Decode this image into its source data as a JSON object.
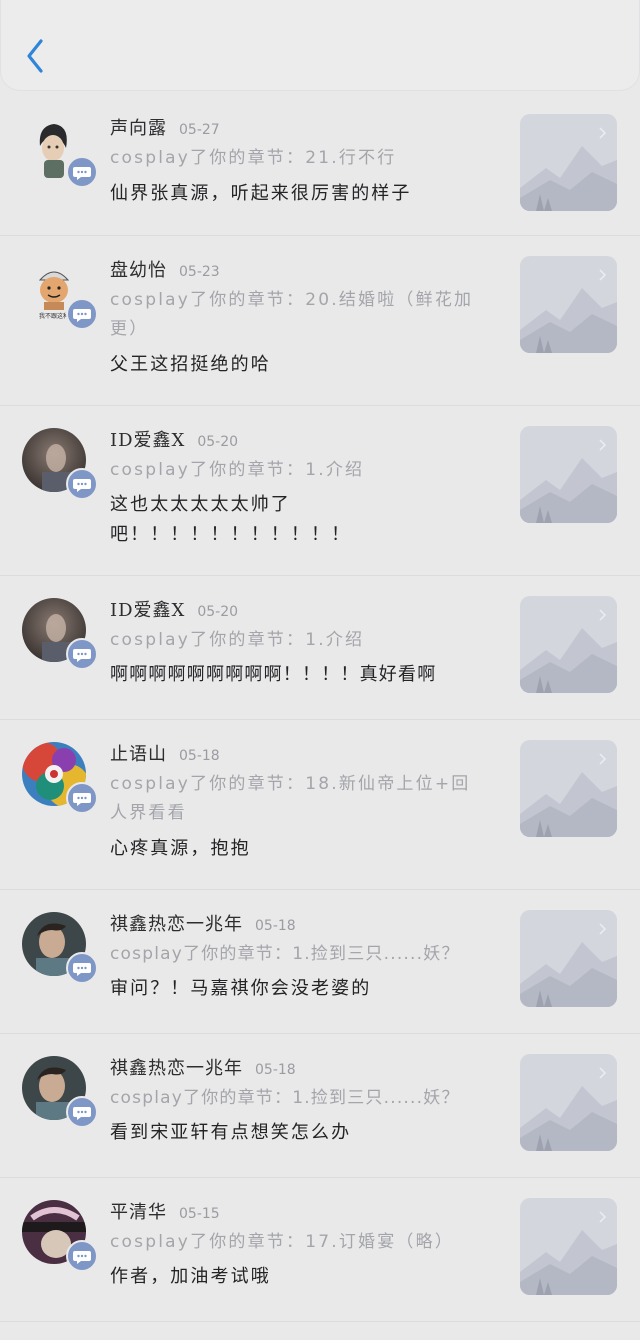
{
  "header": {
    "back_icon": "chevron-left-icon",
    "accent_color": "#2f86d8"
  },
  "comments": [
    {
      "name": "声向露",
      "date": "05-27",
      "subject": "cosplay了你的章节：21.行不行",
      "comment": "仙界张真源，听起来很厉害的样子",
      "avatar_caption": ""
    },
    {
      "name": "盘幼怡",
      "date": "05-23",
      "subject": "cosplay了你的章节：20.结婚啦（鲜花加更）",
      "comment": "父王这招挺绝的哈",
      "avatar_caption": "我不跟这种"
    },
    {
      "name": "ID爱鑫X",
      "date": "05-20",
      "subject": "cosplay了你的章节：1.介绍",
      "comment": "这也太太太太太帅了吧！！！！！！！！！！！",
      "avatar_caption": ""
    },
    {
      "name": "ID爱鑫X",
      "date": "05-20",
      "subject": "cosplay了你的章节：1.介绍",
      "comment": "啊啊啊啊啊啊啊啊啊！！！！真好看啊",
      "avatar_caption": ""
    },
    {
      "name": "止语山",
      "date": "05-18",
      "subject": "cosplay了你的章节：18.新仙帝上位+回人界看看",
      "comment": "心疼真源，抱抱",
      "avatar_caption": ""
    },
    {
      "name": "祺鑫热恋一兆年",
      "date": "05-18",
      "subject": "cosplay了你的章节：1.捡到三只......妖？",
      "comment": "审问？！马嘉祺你会没老婆的",
      "avatar_caption": ""
    },
    {
      "name": "祺鑫热恋一兆年",
      "date": "05-18",
      "subject": "cosplay了你的章节：1.捡到三只......妖？",
      "comment": "看到宋亚轩有点想笑怎么办",
      "avatar_caption": ""
    },
    {
      "name": "平清华",
      "date": "05-15",
      "subject": "cosplay了你的章节：17.订婚宴（略）",
      "comment": "作者，加油考试哦",
      "avatar_caption": ""
    }
  ],
  "icons": {
    "badge": "chat-bubble-icon",
    "thumbnail": "mountain-landscape-icon"
  }
}
